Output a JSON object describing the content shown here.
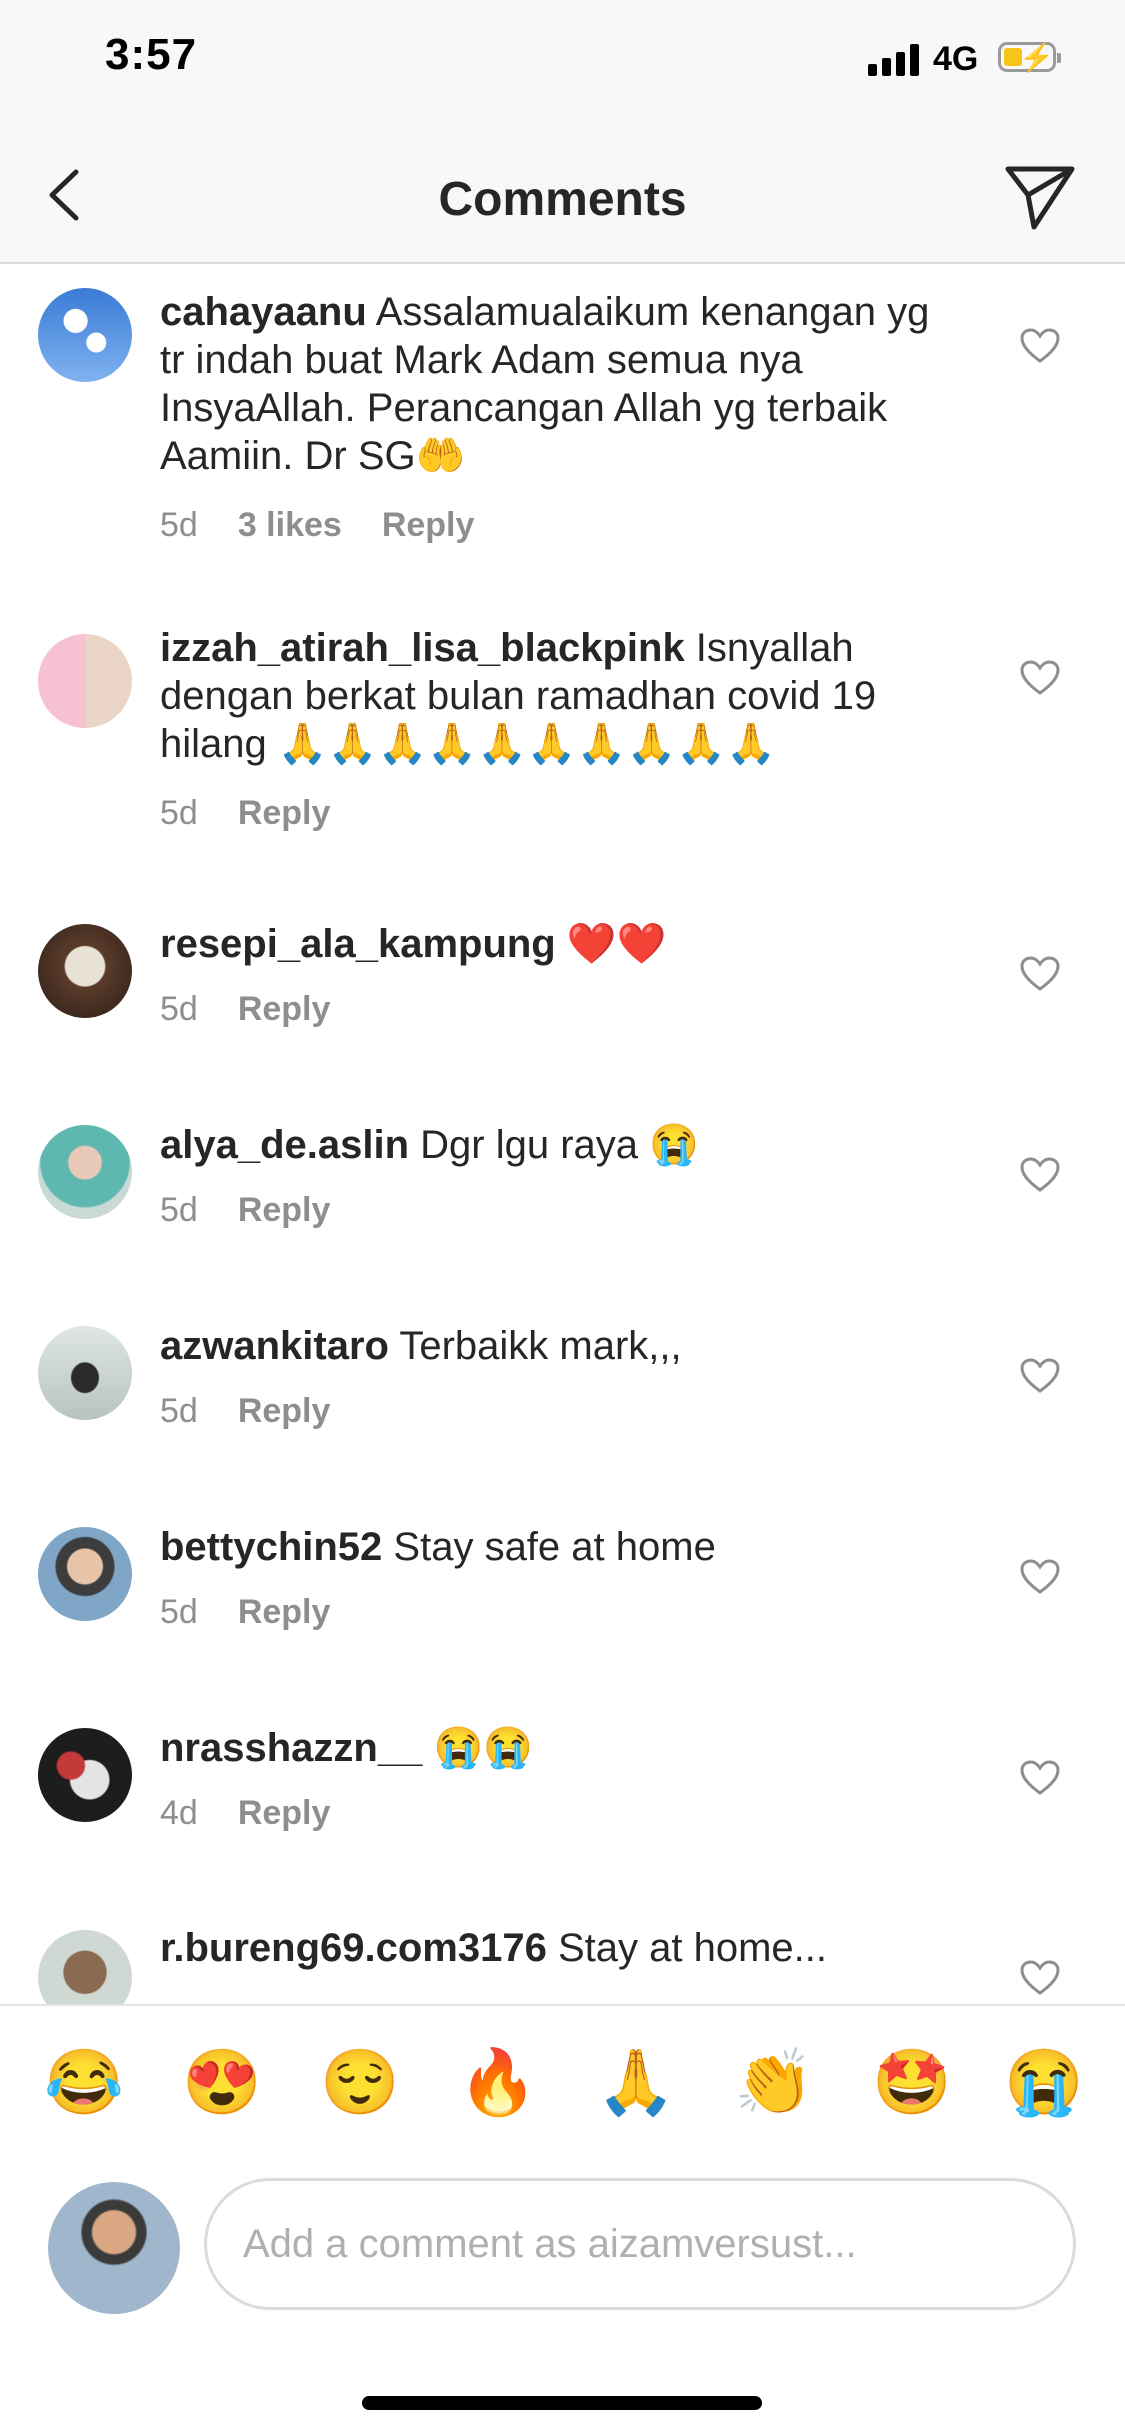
{
  "status_bar": {
    "time": "3:57",
    "network": "4G"
  },
  "header": {
    "title": "Comments"
  },
  "comments": [
    {
      "user": "cahayaanu",
      "text": " Assalamualaikum kenangan yg tr indah buat Mark Adam semua nya InsyaAllah. Perancangan Allah yg terbaik Aamiin. Dr SG🤲",
      "age": "5d",
      "likes": "3 likes",
      "reply": "Reply"
    },
    {
      "user": "izzah_atirah_lisa_blackpink",
      "text": " Isnyallah dengan berkat bulan ramadhan covid 19 hilang 🙏🙏🙏🙏🙏🙏🙏🙏🙏🙏",
      "age": "5d",
      "reply": "Reply"
    },
    {
      "user": "resepi_ala_kampung",
      "text": " ❤️❤️",
      "age": "5d",
      "reply": "Reply"
    },
    {
      "user": "alya_de.aslin",
      "text": " Dgr lgu raya 😭",
      "age": "5d",
      "reply": "Reply"
    },
    {
      "user": "azwankitaro",
      "text": " Terbaikk mark,,,",
      "age": "5d",
      "reply": "Reply"
    },
    {
      "user": "bettychin52",
      "text": " Stay safe at home",
      "age": "5d",
      "reply": "Reply"
    },
    {
      "user": "nrasshazzn__",
      "text": " 😭😭",
      "age": "4d",
      "reply": "Reply"
    },
    {
      "user": "r.bureng69.com3176",
      "text": " Stay at home...",
      "age": "",
      "reply": ""
    }
  ],
  "emoji_bar": [
    "😂",
    "😍",
    "😌",
    "🔥",
    "🙏",
    "👏",
    "🤩",
    "😭"
  ],
  "composer": {
    "placeholder": "Add a comment as aizamversust..."
  },
  "icons": {
    "back": "chevron-left-icon",
    "send": "paper-plane-icon",
    "heart": "heart-outline-icon"
  }
}
